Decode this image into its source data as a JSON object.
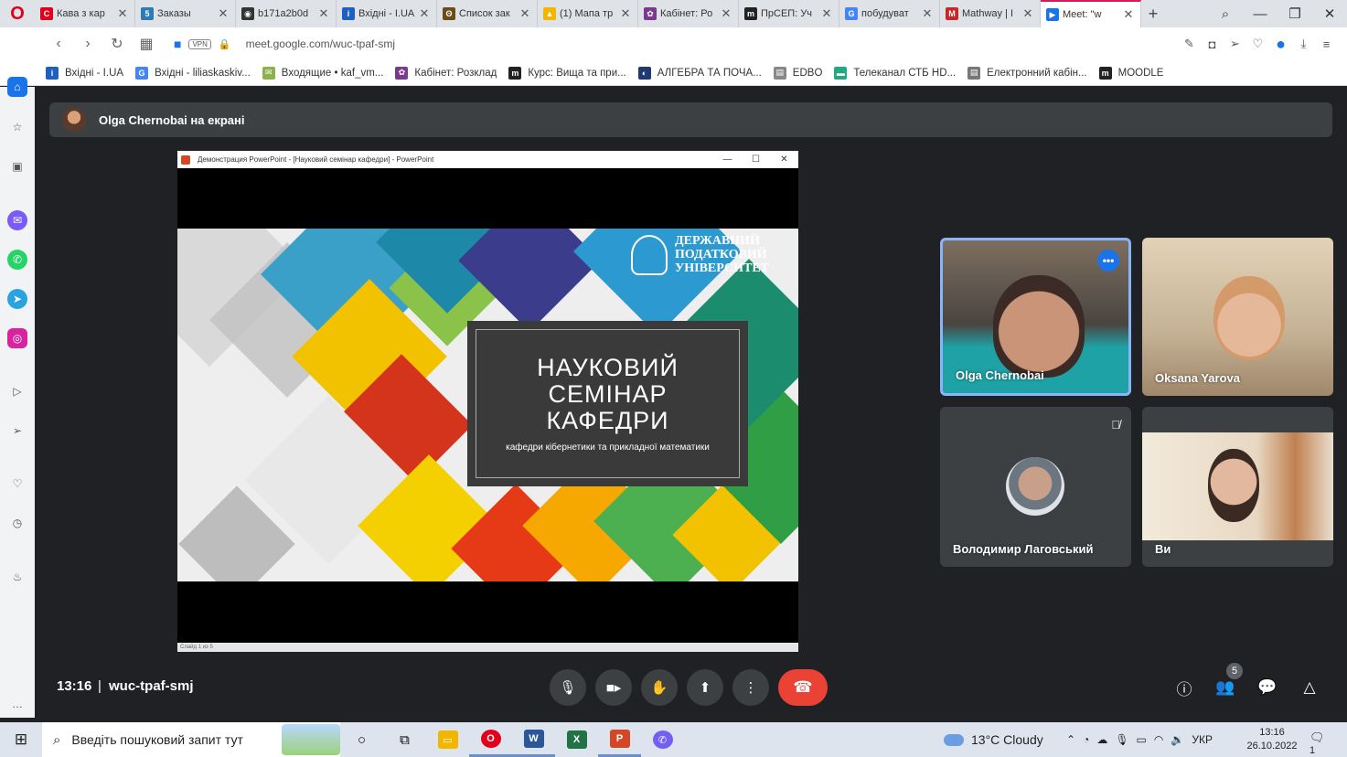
{
  "browser": {
    "tabs": [
      {
        "label": "Кава з кар",
        "icon": "opera-red",
        "color": "#e0001b",
        "glyph": "C"
      },
      {
        "label": "Заказы",
        "icon": "five-icon",
        "color": "#2c7bb6",
        "glyph": "5"
      },
      {
        "label": "b171a2b0d",
        "icon": "globe-icon",
        "color": "#333333",
        "glyph": "◉"
      },
      {
        "label": "Вхідні - I.UA",
        "icon": "iua-icon",
        "color": "#1f5fbf",
        "glyph": "i"
      },
      {
        "label": "Список зак",
        "icon": "owl-icon",
        "color": "#6d4c1a",
        "glyph": "ʘ"
      },
      {
        "label": "(1) Мапа тр",
        "icon": "warning-icon",
        "color": "#f2b600",
        "glyph": "▲"
      },
      {
        "label": "Кабінет: Ро",
        "icon": "cabinet-icon",
        "color": "#7c3a8f",
        "glyph": "✿"
      },
      {
        "label": "ПрСЕП: Уч",
        "icon": "moodle-icon",
        "color": "#222222",
        "glyph": "m"
      },
      {
        "label": "побудуват",
        "icon": "google-icon",
        "color": "#4285f4",
        "glyph": "G"
      },
      {
        "label": "Mathway | I",
        "icon": "mathway-icon",
        "color": "#c62828",
        "glyph": "M"
      },
      {
        "label": "Meet: \"w",
        "icon": "meet-icon",
        "color": "#1a73e8",
        "glyph": "▶",
        "active": true
      }
    ],
    "url": "meet.google.com/wuc-tpaf-smj",
    "vpn_label": "VPN",
    "bookmarks": [
      {
        "label": "Вхідні - I.UA",
        "color": "#1f5fbf",
        "glyph": "i"
      },
      {
        "label": "Вхідні - liliaskaskiv...",
        "color": "#4285f4",
        "glyph": "G"
      },
      {
        "label": "Входящие • kaf_vm...",
        "color": "#8bb14a",
        "glyph": "✉"
      },
      {
        "label": "Кабінет: Розклад",
        "color": "#7c3a8f",
        "glyph": "✿"
      },
      {
        "label": "Курс: Вища та при...",
        "color": "#222222",
        "glyph": "m"
      },
      {
        "label": "АЛГЕБРА ТА ПОЧА...",
        "color": "#1e3a6e",
        "glyph": "◐"
      },
      {
        "label": "EDBO",
        "color": "#888888",
        "glyph": "▤"
      },
      {
        "label": "Телеканал СТБ HD...",
        "color": "#22a884",
        "glyph": "▬"
      },
      {
        "label": "Електронний кабін...",
        "color": "#777777",
        "glyph": "▤"
      },
      {
        "label": "MOODLE",
        "color": "#222222",
        "glyph": "m"
      }
    ]
  },
  "meet": {
    "presenter_text": "Olga Chernobai на екрані",
    "time": "13:16",
    "separator": "|",
    "meeting_code": "wuc-tpaf-smj",
    "participant_count": "5",
    "participants": [
      {
        "name": "Olga Chernobai"
      },
      {
        "name": "Oksana Yarova"
      },
      {
        "name": "Володимир Лаговський"
      },
      {
        "name": "Ви"
      }
    ]
  },
  "presentation": {
    "window_title": "Демонстрация PowerPoint - [Науковий семінар кафедри] - PowerPoint",
    "logo_text": [
      "ДЕРЖАВНИЙ",
      "ПОДАТКОВИЙ",
      "УНІВЕРСИТЕТ"
    ],
    "slide_title": [
      "НАУКОВИЙ",
      "СЕМІНАР",
      "КАФЕДРИ"
    ],
    "slide_subtitle": "кафедри кібернетики та прикладної математики",
    "status_text": "Слайд 1 из 5"
  },
  "taskbar": {
    "search_placeholder": "Введіть пошуковий запит тут",
    "weather": "13°C  Cloudy",
    "language": "УКР",
    "clock_time": "13:16",
    "clock_date": "26.10.2022",
    "notification_count": "1"
  }
}
